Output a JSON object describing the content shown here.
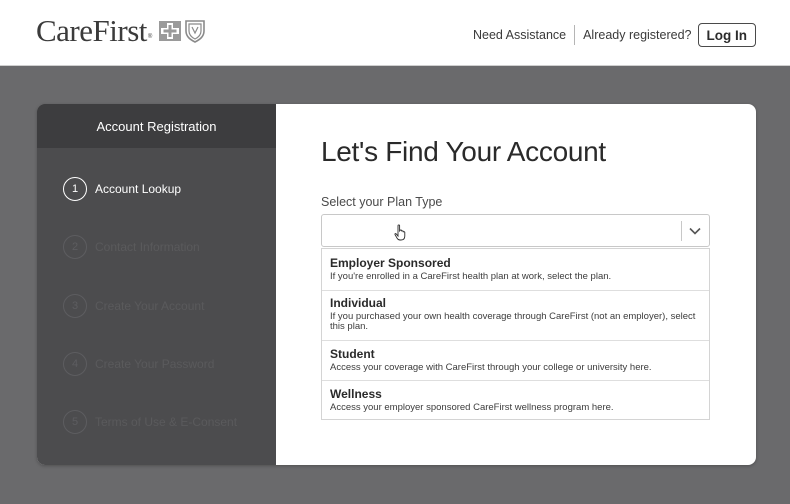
{
  "header": {
    "logo_text": "CareFirst",
    "logo_tm": "®",
    "need_assistance": "Need Assistance",
    "already_registered": "Already registered?",
    "login_label": "Log In"
  },
  "sidebar": {
    "title": "Account Registration",
    "steps": [
      {
        "num": "1",
        "label": "Account Lookup"
      },
      {
        "num": "2",
        "label": "Contact Information"
      },
      {
        "num": "3",
        "label": "Create Your Account"
      },
      {
        "num": "4",
        "label": "Create Your Password"
      },
      {
        "num": "5",
        "label": "Terms of Use & E-Consent"
      }
    ]
  },
  "main": {
    "title": "Let's Find Your Account",
    "plan_label": "Select your Plan Type",
    "plan_value": "",
    "options": [
      {
        "title": "Employer Sponsored",
        "desc": "If you're enrolled in a CareFirst health plan at work, select the plan."
      },
      {
        "title": "Individual",
        "desc": "If you purchased your own health coverage through CareFirst (not an employer), select this plan."
      },
      {
        "title": "Student",
        "desc": "Access your coverage with CareFirst through your college or university here."
      },
      {
        "title": "Wellness",
        "desc": "Access your employer sponsored CareFirst wellness program here."
      }
    ]
  },
  "colors": {
    "page_bg": "#6a6a6c",
    "sidebar_bg": "#4c4c4e",
    "sidebar_header_bg": "#3d3d3f",
    "inactive_step": "#5d5d60"
  },
  "icons": [
    "cross-logo-icon",
    "shield-logo-icon",
    "chevron-down-icon",
    "hand-cursor-icon"
  ]
}
